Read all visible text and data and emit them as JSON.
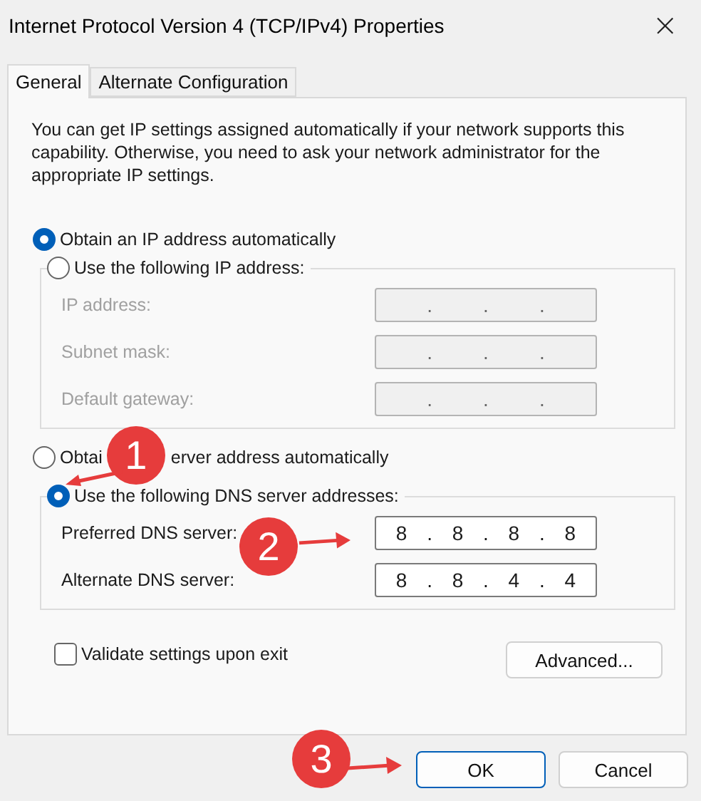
{
  "window": {
    "title": "Internet Protocol Version 4 (TCP/IPv4) Properties",
    "close": "×"
  },
  "tabs": [
    {
      "label": "General",
      "selected": true
    },
    {
      "label": "Alternate Configuration",
      "selected": false
    }
  ],
  "description": "You can get IP settings assigned automatically if your network supports this capability. Otherwise, you need to ask your network administrator for the appropriate IP settings.",
  "octet_separator": ".",
  "ip_section": {
    "auto_option": {
      "label": "Obtain an IP address automatically",
      "selected": true
    },
    "manual_option": {
      "label": "Use the following IP address:",
      "selected": false
    },
    "fields": [
      {
        "label": "IP address:",
        "disabled": true
      },
      {
        "label": "Subnet mask:",
        "disabled": true
      },
      {
        "label": "Default gateway:",
        "disabled": true
      }
    ]
  },
  "dns_section": {
    "auto_option": {
      "label_parts": [
        "Obtai",
        "erver address automatically"
      ],
      "selected": false
    },
    "manual_option": {
      "label": "Use the following DNS server addresses:",
      "selected": true
    },
    "fields": [
      {
        "label": "Preferred DNS server:",
        "disabled": false,
        "octets": [
          "8",
          "8",
          "8",
          "8"
        ]
      },
      {
        "label": "Alternate DNS server:",
        "disabled": false,
        "octets": [
          "8",
          "8",
          "4",
          "4"
        ]
      }
    ]
  },
  "validate": {
    "label": "Validate settings upon exit",
    "checked": false
  },
  "advanced_button": "Advanced...",
  "buttons": [
    {
      "label": "OK",
      "default": true
    },
    {
      "label": "Cancel",
      "default": false
    }
  ],
  "annotations": [
    "1",
    "2",
    "3"
  ]
}
